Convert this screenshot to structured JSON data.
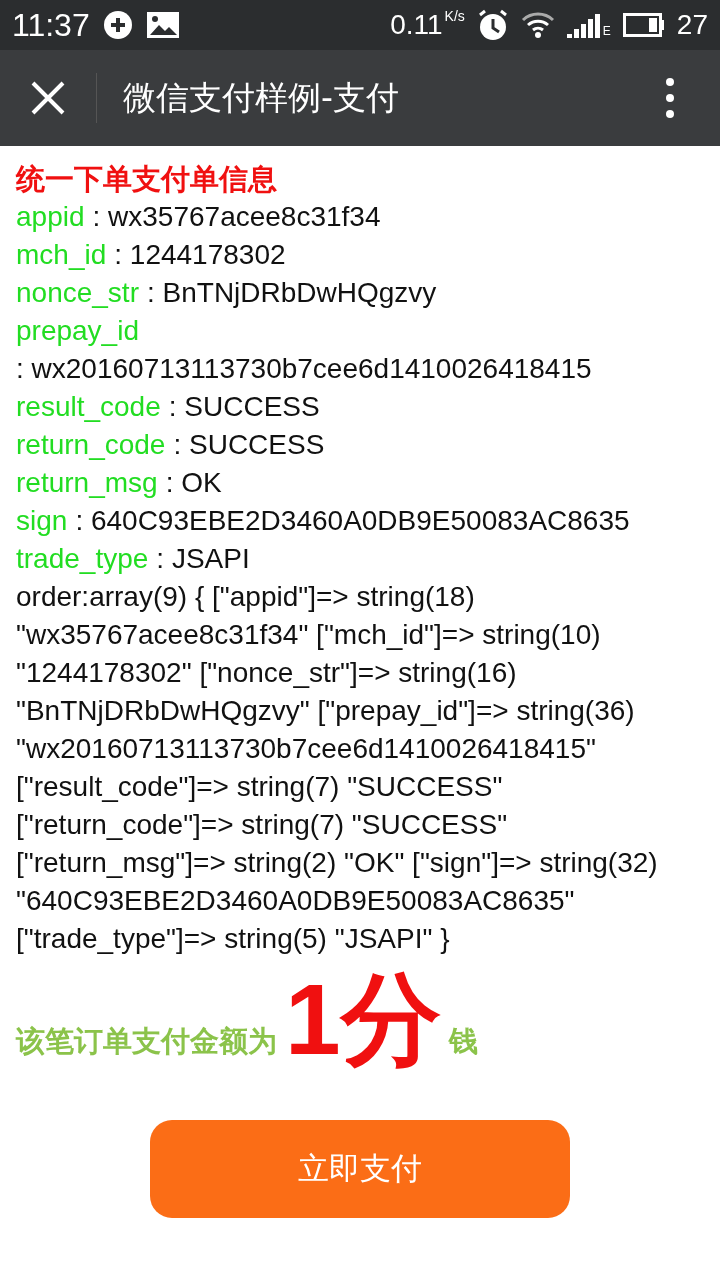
{
  "status_bar": {
    "time": "11:37",
    "speed": "0.11",
    "speed_unit": "K/s",
    "network": "E",
    "battery": "27"
  },
  "title_bar": {
    "title": "微信支付样例-支付"
  },
  "heading": "统一下单支付单信息",
  "fields": [
    {
      "key": "appid",
      "value": ": wx35767acee8c31f34"
    },
    {
      "key": "mch_id",
      "value": ": 1244178302"
    },
    {
      "key": "nonce_str",
      "value": ": BnTNjDRbDwHQgzvy"
    },
    {
      "key": "prepay_id",
      "value": ": wx20160713113730b7cee6d1410026418415"
    },
    {
      "key": "result_code",
      "value": ": SUCCESS"
    },
    {
      "key": "return_code",
      "value": ": SUCCESS"
    },
    {
      "key": "return_msg",
      "value": ": OK"
    },
    {
      "key": "sign",
      "value": ": 640C93EBE2D3460A0DB9E50083AC8635"
    },
    {
      "key": "trade_type",
      "value": ": JSAPI"
    }
  ],
  "order_dump": "order:array(9) { [\"appid\"]=> string(18) \"wx35767acee8c31f34\" [\"mch_id\"]=> string(10) \"1244178302\" [\"nonce_str\"]=> string(16) \"BnTNjDRbDwHQgzvy\" [\"prepay_id\"]=> string(36) \"wx20160713113730b7cee6d1410026418415\" [\"result_code\"]=> string(7) \"SUCCESS\" [\"return_code\"]=> string(7) \"SUCCESS\" [\"return_msg\"]=> string(2) \"OK\" [\"sign\"]=> string(32) \"640C93EBE2D3460A0DB9E50083AC8635\" [\"trade_type\"]=> string(5) \"JSAPI\" }",
  "amount": {
    "prefix": "该笔订单支付金额为",
    "value": "1分",
    "suffix": "钱"
  },
  "pay_button": "立即支付"
}
